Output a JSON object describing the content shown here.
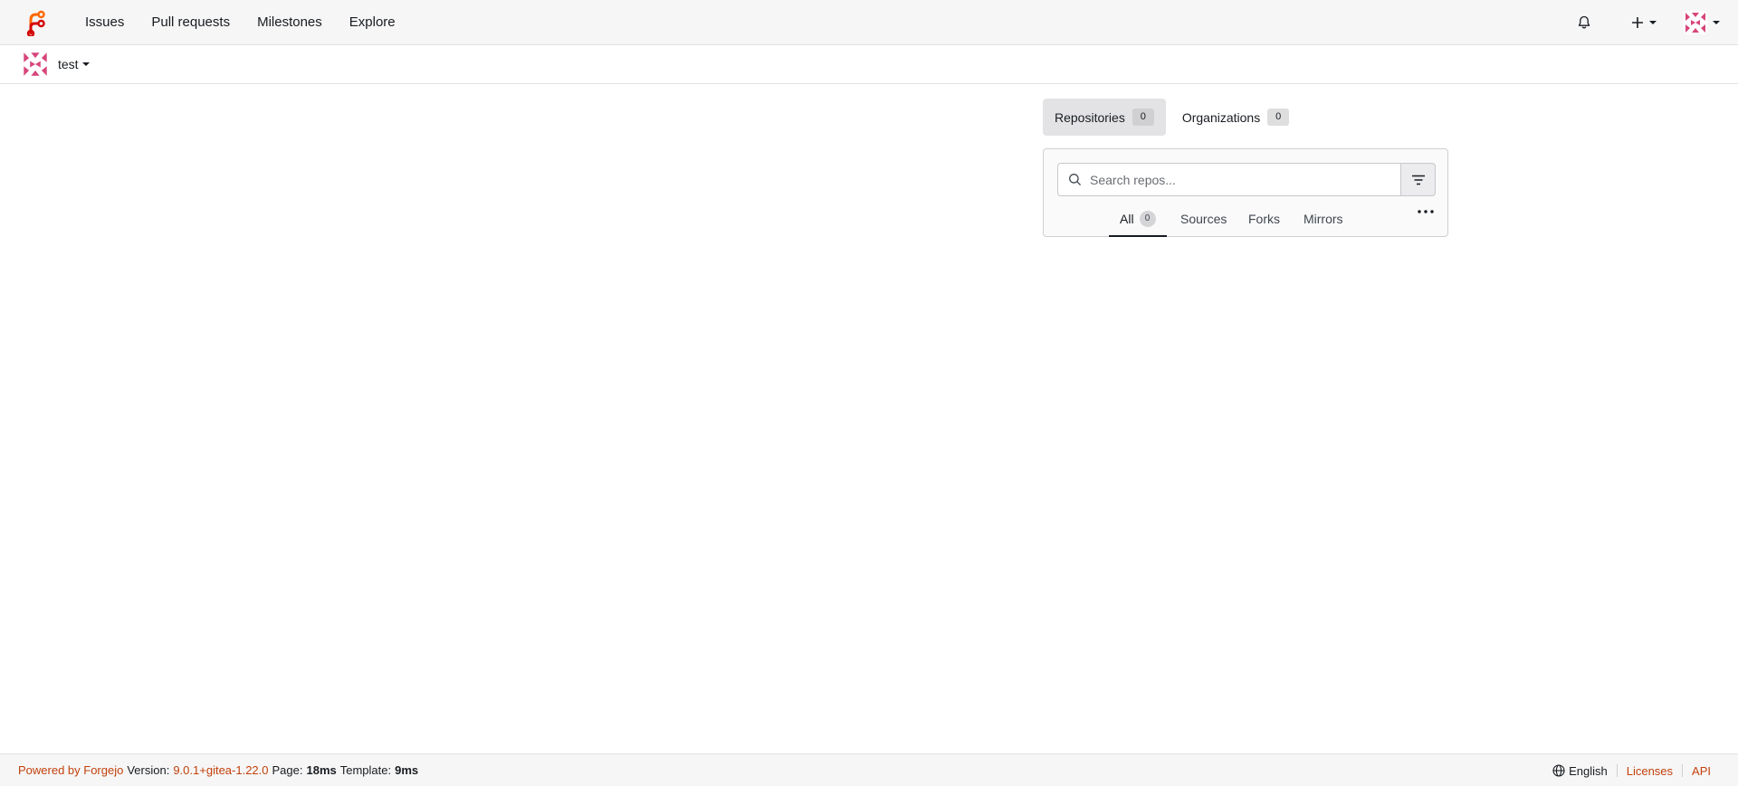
{
  "nav": {
    "links": [
      "Issues",
      "Pull requests",
      "Milestones",
      "Explore"
    ]
  },
  "context": {
    "username": "test"
  },
  "panel": {
    "tabs": [
      {
        "label": "Repositories",
        "count": "0"
      },
      {
        "label": "Organizations",
        "count": "0"
      }
    ],
    "search_placeholder": "Search repos...",
    "subtabs": {
      "all": {
        "label": "All",
        "count": "0"
      },
      "sources": "Sources",
      "forks": "Forks",
      "mirrors": "Mirrors"
    }
  },
  "footer": {
    "powered": "Powered by Forgejo",
    "version_label": "Version:",
    "version": "9.0.1+gitea-1.22.0",
    "page_label": "Page:",
    "page_time": "18ms",
    "template_label": "Template:",
    "template_time": "9ms",
    "language": "English",
    "licenses": "Licenses",
    "api": "API"
  },
  "colors": {
    "accent": "#c2410c",
    "logo_orange": "#ff6600",
    "logo_red": "#d40000",
    "avatar_pink": "#d6457a"
  }
}
